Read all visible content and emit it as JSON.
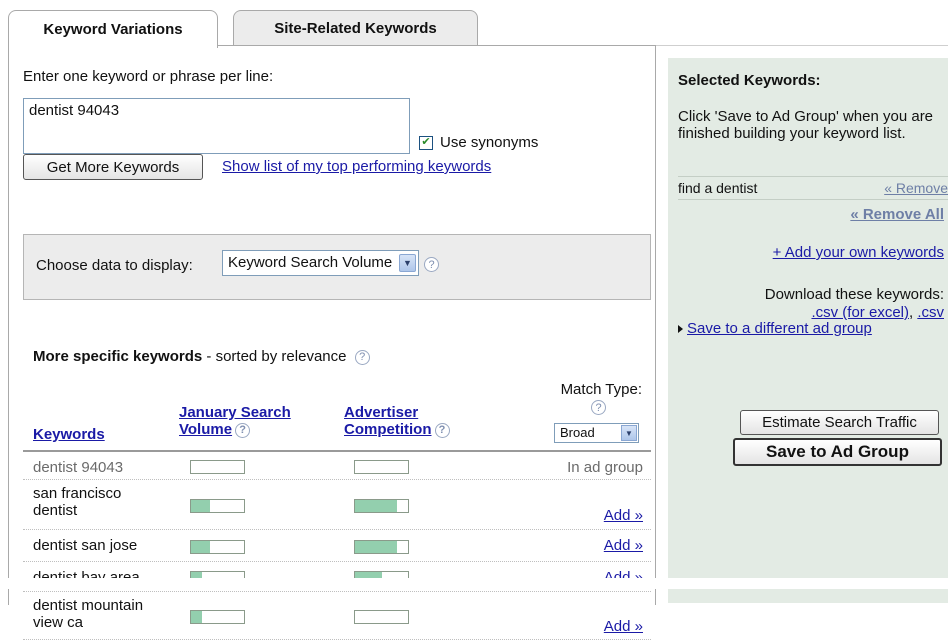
{
  "tabs": {
    "active": "Keyword Variations",
    "inactive": "Site-Related Keywords"
  },
  "entry": {
    "prompt": "Enter one keyword or phrase per line:",
    "value": "dentist 94043",
    "use_synonyms_label": "Use synonyms",
    "use_synonyms_checked": true,
    "get_more_button": "Get More Keywords",
    "top_performing_link": "Show list of my top performing keywords"
  },
  "data_display": {
    "label": "Choose data to display:",
    "selected": "Keyword Search Volume"
  },
  "results": {
    "title_bold": "More specific keywords",
    "title_rest": " - sorted by relevance",
    "col_keywords": "Keywords",
    "col_volume_line1": "January Search",
    "col_volume_line2": "Volume",
    "col_competition_line1": "Advertiser",
    "col_competition_line2": "Competition",
    "match_type_label": "Match Type:",
    "match_type_value": "Broad",
    "rows": [
      {
        "keyword": "dentist 94043",
        "volume": 0.0,
        "competition": 0.0,
        "action": "In ad group",
        "in_group": true
      },
      {
        "keyword": "san francisco dentist",
        "volume": 0.35,
        "competition": 0.8,
        "action": "Add »",
        "in_group": false
      },
      {
        "keyword": "dentist san jose",
        "volume": 0.35,
        "competition": 0.8,
        "action": "Add »",
        "in_group": false
      },
      {
        "keyword": "dentist bay area",
        "volume": 0.2,
        "competition": 0.5,
        "action": "Add »",
        "in_group": false
      },
      {
        "keyword": "dentist mountain view ca",
        "volume": 0.2,
        "competition": 0.0,
        "action": "Add »",
        "in_group": false
      }
    ]
  },
  "selected_panel": {
    "title": "Selected Keywords:",
    "instructions": "Click 'Save to Ad Group' when you are finished building your keyword list.",
    "selected_keyword": "find a dentist",
    "remove_link": "« Remove",
    "remove_all_link": "« Remove All",
    "add_own_link": "+ Add your own keywords",
    "download_label": "Download these keywords:",
    "csv_excel_link": ".csv (for excel)",
    "csv_separator": ",",
    "csv_link": ".csv",
    "save_different_link": "Save to a different ad group",
    "estimate_button": "Estimate Search Traffic",
    "save_button": "Save to Ad Group"
  },
  "colors": {
    "bar_fill": "#93cfae",
    "link": "#1a1aa6",
    "panel_bg": "#e3ebe4"
  },
  "icons": {
    "help": "?",
    "checkmark": "✔",
    "dropdown_arrow": "▼"
  }
}
